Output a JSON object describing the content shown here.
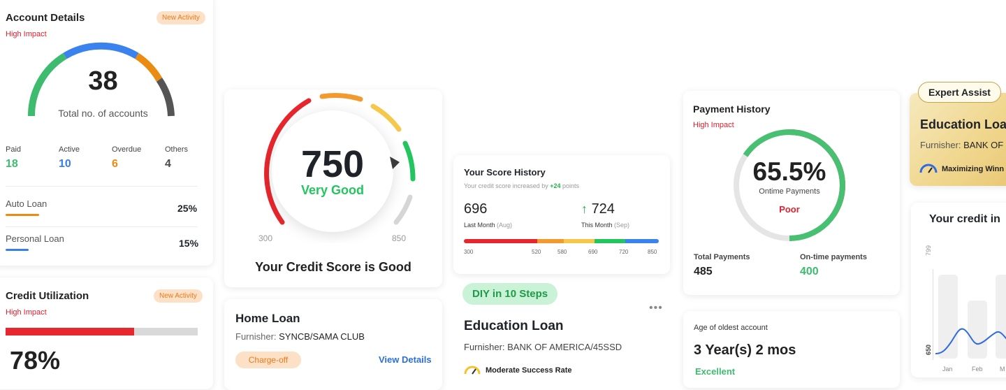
{
  "account_details": {
    "title": "Account Details",
    "impact": "High Impact",
    "badge": "New Activity",
    "total": "38",
    "total_label": "Total no. of accounts",
    "stats": [
      {
        "label": "Paid",
        "value": "18",
        "color": "#3dbb6e"
      },
      {
        "label": "Active",
        "value": "10",
        "color": "#3a7ee8"
      },
      {
        "label": "Overdue",
        "value": "6",
        "color": "#ea8b12"
      },
      {
        "label": "Others",
        "value": "4",
        "color": "#4a4a4a"
      }
    ],
    "loans": [
      {
        "name": "Auto Loan",
        "percent": "25%",
        "color": "#ea8b12"
      },
      {
        "name": "Personal Loan",
        "percent": "15%",
        "color": "#3a7ee8"
      }
    ]
  },
  "credit_utilization": {
    "title": "Credit Utilization",
    "impact": "High Impact",
    "badge": "New Activity",
    "percent": "78%",
    "fill_fraction": 0.67,
    "fill_color": "#e8262d"
  },
  "credit_score": {
    "score": "750",
    "rating": "Very Good",
    "min": "300",
    "max": "850",
    "headline": "Your Credit Score is Good"
  },
  "home_loan": {
    "title": "Home Loan",
    "furnisher_label": "Furnisher: ",
    "furnisher": "SYNCB/SAMA CLUB",
    "status": "Charge-off",
    "link": "View Details"
  },
  "score_history": {
    "title": "Your Score History",
    "subtitle_pre": "Your credit score increased by ",
    "subtitle_delta": "+24",
    "subtitle_post": " points",
    "last_value": "696",
    "last_label": "Last Month",
    "last_period": "(Aug)",
    "this_value": "724",
    "this_label": "This Month",
    "this_period": "(Sep)",
    "scale": [
      "300",
      "520",
      "580",
      "690",
      "720",
      "850"
    ]
  },
  "diy": {
    "badge": "DIY in 10 Steps",
    "title": "Education Loan",
    "furnisher": "Furnisher: BANK OF AMERICA/45SSD",
    "rate": "Moderate Success Rate"
  },
  "payment_history": {
    "title": "Payment History",
    "impact": "High Impact",
    "percent": "65.5%",
    "percent_label": "Ontime Payments",
    "rating": "Poor",
    "ontime_fraction": 0.655,
    "total_label": "Total Payments",
    "total_value": "485",
    "ontime_label": "On-time payments",
    "ontime_value": "400"
  },
  "oldest_account": {
    "label": "Age of oldest account",
    "value": "3 Year(s) 2 mos",
    "rating": "Excellent"
  },
  "expert": {
    "badge": "Expert Assist",
    "title": "Education Loa",
    "furnisher_label": "Furnisher: ",
    "furnisher": "BANK OF",
    "tagline": "Maximizing Winn"
  },
  "credit_insight": {
    "title": "Your credit in",
    "y_top": "799",
    "y_bottom": "650",
    "months": [
      "Jan",
      "Feb",
      "M"
    ]
  }
}
